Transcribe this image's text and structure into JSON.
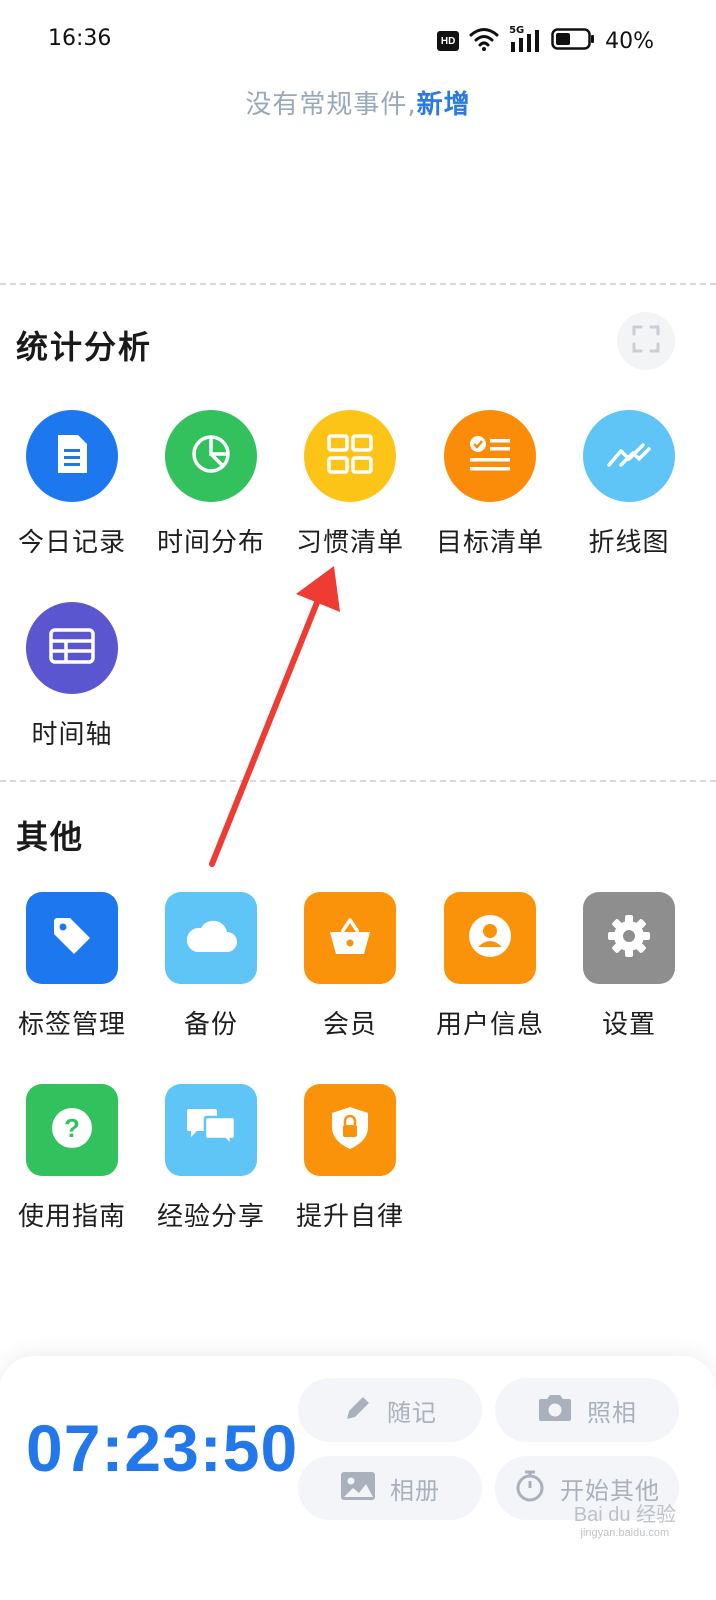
{
  "status_bar": {
    "time": "16:36",
    "hd_label": "HD",
    "network_label": "5G",
    "battery": "40%"
  },
  "routine": {
    "empty_text": "没有常规事件,",
    "add_link": "新增"
  },
  "stats_section": {
    "title": "统计分析",
    "items": [
      {
        "label": "今日记录",
        "icon": "document-icon",
        "color": "#1d78f0"
      },
      {
        "label": "时间分布",
        "icon": "pie-chart-icon",
        "color": "#33c15e"
      },
      {
        "label": "习惯清单",
        "icon": "grid-icon",
        "color": "#fcc416"
      },
      {
        "label": "目标清单",
        "icon": "checklist-icon",
        "color": "#fb8c0a"
      },
      {
        "label": "折线图",
        "icon": "line-chart-icon",
        "color": "#5ec5f6"
      },
      {
        "label": "时间轴",
        "icon": "table-icon",
        "color": "#5a56cf"
      }
    ]
  },
  "other_section": {
    "title": "其他",
    "items": [
      {
        "label": "标签管理",
        "icon": "tag-icon",
        "color": "#1d78f0"
      },
      {
        "label": "备份",
        "icon": "cloud-icon",
        "color": "#5ec5f6"
      },
      {
        "label": "会员",
        "icon": "basket-icon",
        "color": "#fb930a"
      },
      {
        "label": "用户信息",
        "icon": "user-icon",
        "color": "#fb930a"
      },
      {
        "label": "设置",
        "icon": "gear-icon",
        "color": "#8e8e8e"
      },
      {
        "label": "使用指南",
        "icon": "help-icon",
        "color": "#33c15e"
      },
      {
        "label": "经验分享",
        "icon": "chat-icon",
        "color": "#5ec5f6"
      },
      {
        "label": "提升自律",
        "icon": "shield-lock-icon",
        "color": "#fb930a"
      }
    ]
  },
  "bottom_panel": {
    "timer": "07:23:50",
    "actions": [
      {
        "label": "随记",
        "icon": "pencil-icon"
      },
      {
        "label": "照相",
        "icon": "camera-icon"
      },
      {
        "label": "相册",
        "icon": "image-icon"
      },
      {
        "label": "开始其他",
        "icon": "stopwatch-icon"
      }
    ]
  },
  "watermark": {
    "brand": "Bai du 经验",
    "url": "jingyan.baidu.com"
  },
  "colors": {
    "accent": "#2277ea",
    "annotation": "#ee3b33"
  }
}
